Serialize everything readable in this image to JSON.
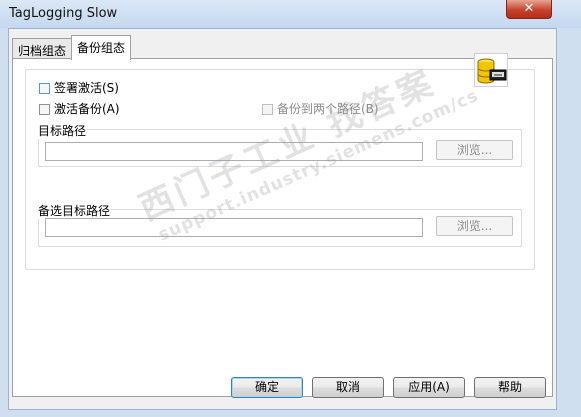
{
  "window": {
    "title": "TagLogging Slow",
    "close_glyph": "✕"
  },
  "tabs": [
    {
      "label": "归档组态",
      "active": false
    },
    {
      "label": "备份组态",
      "active": true
    }
  ],
  "backup": {
    "signature_label": "签署激活(S)",
    "signature_checked": false,
    "activate_backup_label": "激活备份(A)",
    "activate_backup_checked": false,
    "backup_two_paths_label": "备份到两个路径(B)",
    "backup_two_paths_checked": false,
    "target_path_label": "目标路径",
    "target_path_value": "",
    "browse_label": "浏览...",
    "alt_target_path_label": "备选目标路径",
    "alt_target_path_value": "",
    "browse2_label": "浏览..."
  },
  "buttons": {
    "ok": "确定",
    "cancel": "取消",
    "apply": "应用(A)",
    "help": "帮助"
  },
  "watermark": {
    "chinese": "西门子工业  找答案",
    "url": "support.industry.siemens.com/cs"
  },
  "colors": {
    "titlebar": "#cfdff0",
    "close": "#c7432c",
    "panel": "#ffffff",
    "dialog": "#f0f0f0",
    "db_icon": "#f2c500"
  },
  "icons": [
    "close-icon",
    "database-icon"
  ]
}
